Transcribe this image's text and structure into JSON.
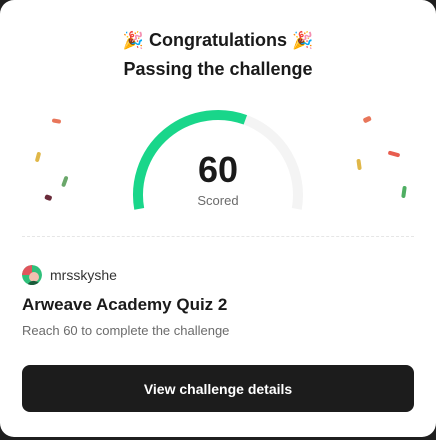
{
  "header": {
    "emoji_left": "🎉",
    "title": "Congratulations",
    "emoji_right": "🎉",
    "subtitle": "Passing the challenge"
  },
  "score": {
    "value": "60",
    "label": "Scored",
    "fraction": 0.6,
    "accent_color": "#19d68a",
    "track_color": "#f4f4f4"
  },
  "challenge": {
    "author": "mrsskyshe",
    "title": "Arweave Academy Quiz 2",
    "description": "Reach 60 to complete the challenge",
    "cta_label": "View challenge details"
  },
  "colors": {
    "confetti": [
      "#e8765a",
      "#e0b748",
      "#6aa76a",
      "#6a2b3a",
      "#e85d4f",
      "#4fae62"
    ]
  }
}
